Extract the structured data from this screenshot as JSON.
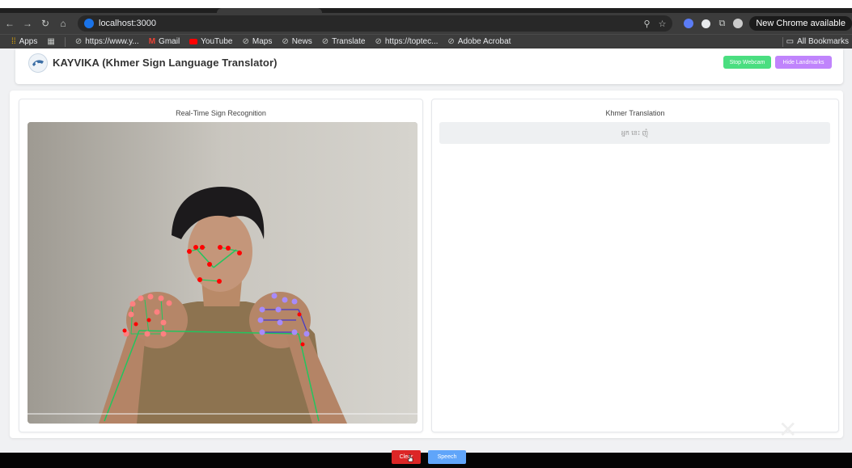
{
  "browser": {
    "url": "localhost:3000",
    "update_chip": "New Chrome available",
    "bookmarks": [
      {
        "label": "Apps",
        "icon": "apps-grid-icon"
      },
      {
        "label": "https://www.y...",
        "icon": "globe-icon"
      },
      {
        "label": "Gmail",
        "icon": "gmail-icon"
      },
      {
        "label": "YouTube",
        "icon": "youtube-icon"
      },
      {
        "label": "Maps",
        "icon": "globe-icon"
      },
      {
        "label": "News",
        "icon": "globe-icon"
      },
      {
        "label": "Translate",
        "icon": "globe-icon"
      },
      {
        "label": "https://toptec...",
        "icon": "globe-icon"
      },
      {
        "label": "Adobe Acrobat",
        "icon": "globe-icon"
      }
    ],
    "all_bookmarks": "All Bookmarks"
  },
  "app": {
    "title": "KAYVIKA (Khmer Sign Language Translator)",
    "buttons": {
      "stop_webcam": "Stop Webcam",
      "hide_landmarks": "Hide Landmarks"
    }
  },
  "panels": {
    "recognition_title": "Real-Time Sign Recognition",
    "translation_title": "Khmer Translation",
    "translation_text": "អ្នក​ នេះ​ ញុំ"
  },
  "footer": {
    "clear_label": "Clear",
    "speech_label": "Speech"
  },
  "colors": {
    "stop_webcam": "#4ade80",
    "hide_landmarks": "#c084fc",
    "clear": "#dc2626",
    "speech": "#60a5fa",
    "face_landmarks": "#ff0000",
    "left_hand": "#ff8080",
    "right_hand": "#a78bfa",
    "pose_lines": "#22c55e"
  }
}
